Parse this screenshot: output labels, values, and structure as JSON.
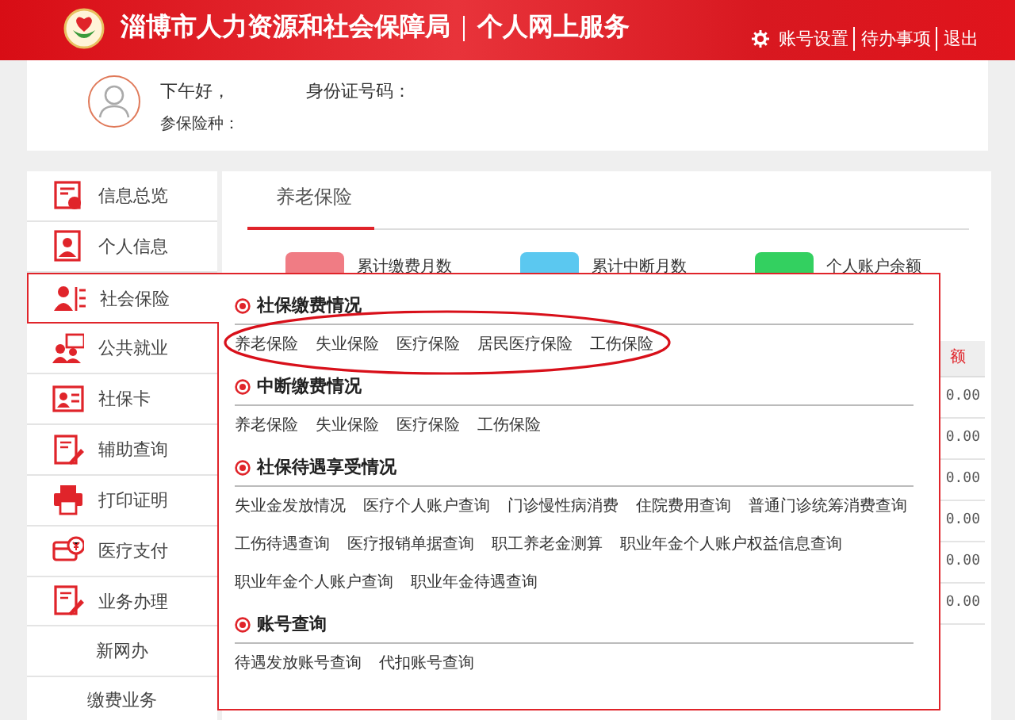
{
  "header": {
    "title": "淄博市人力资源和社会保障局",
    "subtitle": "个人网上服务",
    "links": [
      "账号设置",
      "待办事项",
      "退出"
    ]
  },
  "user": {
    "greeting": "下午好，",
    "id_label": "身份证号码：",
    "insurance_label": "参保险种："
  },
  "sidebar": {
    "items": [
      {
        "label": "信息总览",
        "kind": "main",
        "selected": false
      },
      {
        "label": "个人信息",
        "kind": "main",
        "selected": false
      },
      {
        "label": "社会保险",
        "kind": "main",
        "selected": true
      },
      {
        "label": "公共就业",
        "kind": "main",
        "selected": false
      },
      {
        "label": "社保卡",
        "kind": "main",
        "selected": false
      },
      {
        "label": "辅助查询",
        "kind": "main",
        "selected": false
      },
      {
        "label": "打印证明",
        "kind": "main",
        "selected": false
      },
      {
        "label": "医疗支付",
        "kind": "main",
        "selected": false
      },
      {
        "label": "业务办理",
        "kind": "main",
        "selected": false
      },
      {
        "label": "新网办",
        "kind": "sub",
        "selected": false
      },
      {
        "label": "缴费业务",
        "kind": "sub",
        "selected": false
      }
    ]
  },
  "tabs": [
    {
      "label": "养老保险",
      "selected": true
    }
  ],
  "stats": [
    {
      "label": "累计缴费月数",
      "color": "#f07c84"
    },
    {
      "label": "累计中断月数",
      "color": "#5bc8f0"
    },
    {
      "label": "个人账户余额",
      "color": "#33d060"
    }
  ],
  "table": {
    "column_header": "额",
    "values": [
      "0.00",
      "0.00",
      "0.00",
      "0.00",
      "0.00",
      "0.00"
    ]
  },
  "dropdown": {
    "sections": [
      {
        "title": "社保缴费情况",
        "circled": true,
        "links": [
          "养老保险",
          "失业保险",
          "医疗保险",
          "居民医疗保险",
          "工伤保险"
        ]
      },
      {
        "title": "中断缴费情况",
        "circled": false,
        "links": [
          "养老保险",
          "失业保险",
          "医疗保险",
          "工伤保险"
        ]
      },
      {
        "title": "社保待遇享受情况",
        "circled": false,
        "links": [
          "失业金发放情况",
          "医疗个人账户查询",
          "门诊慢性病消费",
          "住院费用查询",
          "普通门诊统筹消费查询",
          "工伤待遇查询",
          "医疗报销单据查询",
          "职工养老金测算",
          "职业年金个人账户权益信息查询",
          "职业年金个人账户查询",
          "职业年金待遇查询"
        ]
      },
      {
        "title": "账号查询",
        "circled": false,
        "links": [
          "待遇发放账号查询",
          "代扣账号查询"
        ]
      }
    ]
  }
}
